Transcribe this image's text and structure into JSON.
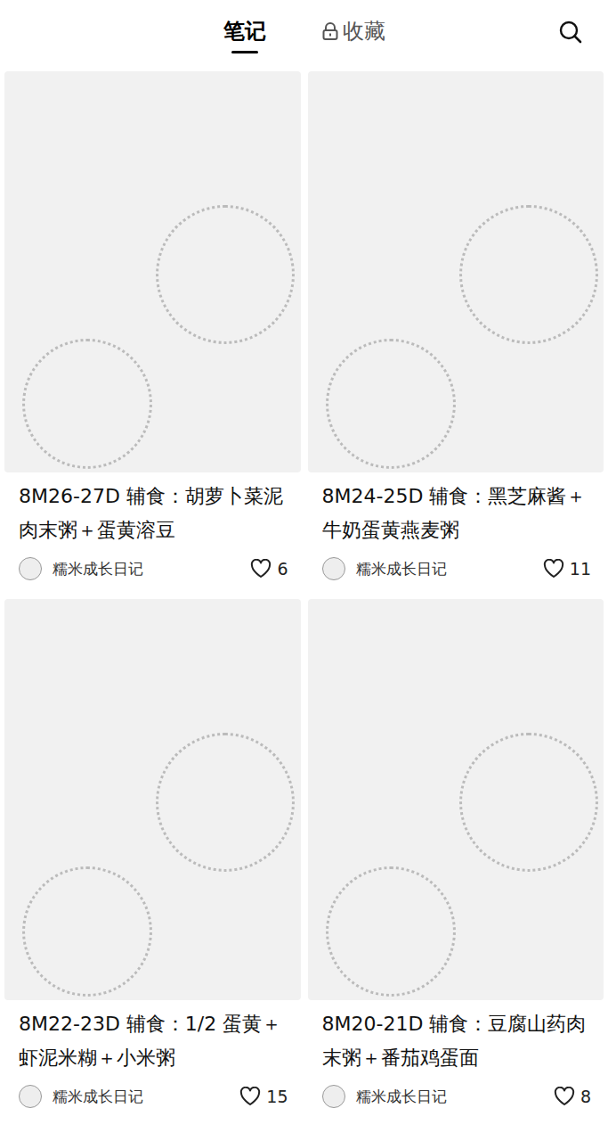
{
  "tabs": [
    {
      "label": "笔记",
      "selected": true,
      "locked": false
    },
    {
      "label": "收藏",
      "selected": false,
      "locked": true
    }
  ],
  "notes": [
    {
      "title": "8M26-27D 辅食：胡萝卜菜泥肉末粥＋蛋黄溶豆",
      "author": "糯米成长日记",
      "likes": "6",
      "liked": false
    },
    {
      "title": "8M24-25D 辅食：黑芝麻酱＋牛奶蛋黄燕麦粥",
      "author": "糯米成长日记",
      "likes": "11",
      "liked": false
    },
    {
      "title": "8M22-23D 辅食：1/2 蛋黄＋虾泥米糊＋小米粥",
      "author": "糯米成长日记",
      "likes": "15",
      "liked": false
    },
    {
      "title": "8M20-21D 辅食：豆腐山药肉末粥＋番茄鸡蛋面",
      "author": "糯米成长日记",
      "likes": "8",
      "liked": false
    }
  ]
}
